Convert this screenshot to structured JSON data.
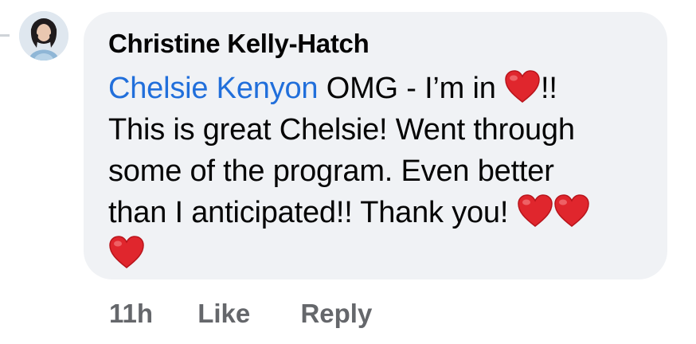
{
  "comment": {
    "author": "Christine Kelly-Hatch",
    "mention": "Chelsie Kenyon",
    "line1_text": " OMG - I’m in ",
    "line1_suffix": "!!",
    "line2": "This is great Chelsie! Went through",
    "line3": "some of the program.  Even better",
    "line4": "than I anticipated!! Thank you! ",
    "emoji": "red-heart"
  },
  "actions": {
    "time": "11h",
    "like": "Like",
    "reply": "Reply"
  },
  "colors": {
    "bubble": "#f0f2f5",
    "mention": "#216fdb",
    "action_text": "#65676b",
    "heart": "#e0262d"
  }
}
